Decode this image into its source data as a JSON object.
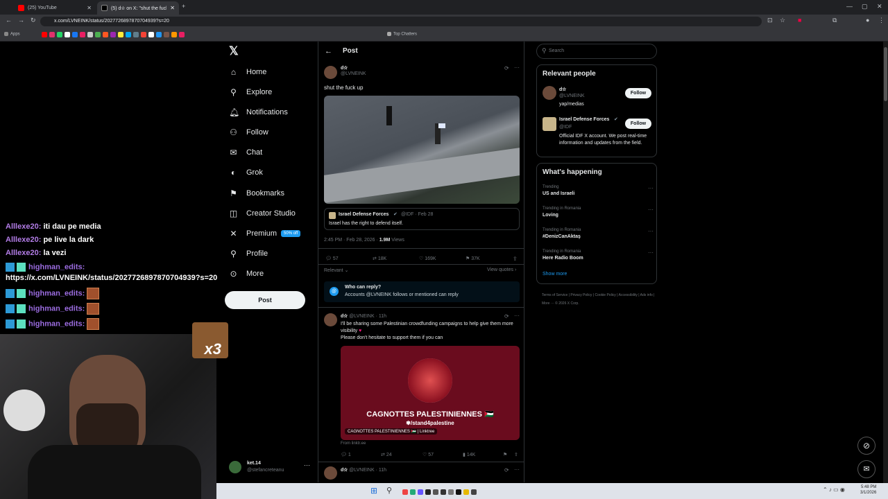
{
  "browser": {
    "tabs": [
      {
        "title": "(25) YouTube"
      },
      {
        "title": "(5) d✫ on X: \"shut the fuck..."
      }
    ],
    "url": "x.com/LVNEINK/status/2027726897870704939?s=20",
    "bookmarks_apps": "Apps",
    "bookmarks_top_chatters": "Top Chatters"
  },
  "chat": {
    "messages": [
      {
        "user": "Alllexe20:",
        "text": "iti dau pe media"
      },
      {
        "user": "Alllexe20:",
        "text": "pe live la dark"
      },
      {
        "user": "Alllexe20:",
        "text": "la vezi"
      },
      {
        "user": "highman_edits:",
        "text": ""
      },
      {
        "user": "",
        "text": "https://x.com/LVNEINK/status/2027726897870704939?s=20"
      },
      {
        "user": "highman_edits:",
        "text": ""
      },
      {
        "user": "highman_edits:",
        "text": ""
      },
      {
        "user": "highman_edits:",
        "text": ""
      }
    ],
    "emote_caption": "x3"
  },
  "nav": {
    "items": [
      {
        "label": "Home",
        "icon": "home-icon"
      },
      {
        "label": "Explore",
        "icon": "search-icon"
      },
      {
        "label": "Notifications",
        "icon": "bell-icon"
      },
      {
        "label": "Follow",
        "icon": "person-plus-icon"
      },
      {
        "label": "Chat",
        "icon": "mail-icon"
      },
      {
        "label": "Grok",
        "icon": "grok-icon"
      },
      {
        "label": "Bookmarks",
        "icon": "bookmark-icon"
      },
      {
        "label": "Creator Studio",
        "icon": "studio-icon"
      },
      {
        "label": "Premium",
        "icon": "x-icon"
      },
      {
        "label": "Profile",
        "icon": "person-icon"
      },
      {
        "label": "More",
        "icon": "more-icon"
      }
    ],
    "premium_badge": "50% off",
    "post_button": "Post",
    "account_name": "ket.14",
    "account_handle": "@stefancreteanu"
  },
  "main": {
    "header": "Post",
    "tweet": {
      "name": "d✫",
      "handle": "@LVNEINK",
      "text": "shut the fuck up",
      "quote": {
        "name": "Israel Defense Forces",
        "handle": "@IDF · Feb 28",
        "text": "Israel has the right to defend itself."
      },
      "time": "2:45 PM · Feb 28, 2026 ·",
      "views_count": "1.9M",
      "views_label": "Views",
      "replies": "57",
      "reposts": "18K",
      "likes": "169K",
      "bookmarks": "37K",
      "relevant": "Relevant",
      "view_quotes": "View quotes"
    },
    "reply_box": {
      "title": "Who can reply?",
      "text": "Accounts @LVNEINK follows or mentioned can reply"
    },
    "reply": {
      "name": "d✫",
      "handle": "@LVNEINK · 11h",
      "text1": "I'll be sharing some Palestinian crowdfunding campaigns to help give them more visibility",
      "text2": "Please don't hesitate to support them if you can",
      "card_title": "CAGNOTTES PALESTINIENNES 🇵🇸",
      "card_sub": "/stand4palestine",
      "card_tag": "CAGNOTTES PALESTINIENNES 🇵🇸 | Linktree",
      "from": "From linktr.ee",
      "replies": "1",
      "reposts": "24",
      "likes": "57",
      "views": "14K"
    },
    "next": {
      "name": "d✫",
      "handle": "@LVNEINK · 11h"
    }
  },
  "right": {
    "search_placeholder": "Search",
    "relevant_title": "Relevant people",
    "people": [
      {
        "name": "d✫",
        "handle": "@LVNEINK",
        "bio": "yap/medias",
        "follow": "Follow"
      },
      {
        "name": "Israel Defense Forces",
        "handle": "@IDF",
        "bio": "Official IDF X account. We post real-time information and updates from the field.",
        "follow": "Follow"
      }
    ],
    "happening_title": "What's happening",
    "trends": [
      {
        "context": "Trending",
        "name": "US and Israeli"
      },
      {
        "context": "Trending in Romania",
        "name": "Loving"
      },
      {
        "context": "Trending in Romania",
        "name": "#DenizCanAktaş"
      },
      {
        "context": "Trending in Romania",
        "name": "Here Radio Boom"
      }
    ],
    "show_more": "Show more",
    "footer": [
      "Terms of Service",
      "Privacy Policy",
      "Cookie Policy",
      "Accessibility",
      "Ads info",
      "More ···",
      "© 2026 X Corp."
    ]
  },
  "taskbar": {
    "time": "5:48 PM",
    "date": "3/1/2026"
  }
}
